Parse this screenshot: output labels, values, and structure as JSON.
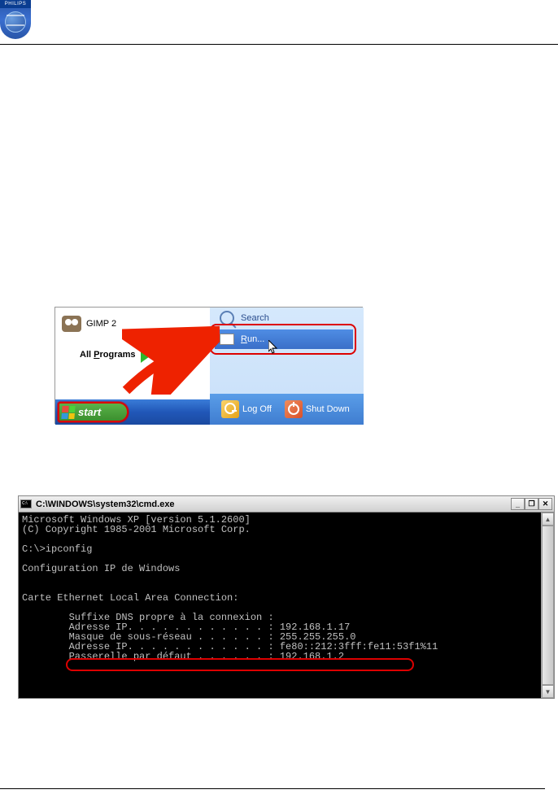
{
  "logo": {
    "brand": "PHILIPS"
  },
  "startmenu": {
    "gimp": "GIMP 2",
    "all_programs_pre": "All ",
    "all_programs_u": "P",
    "all_programs_post": "rograms",
    "search_u": "S",
    "search_post": "earch",
    "run_u": "R",
    "run_post": "un...",
    "logoff_u": "L",
    "logoff_post": "og Off",
    "shutdown": "Sh",
    "shutdown_u": "u",
    "shutdown_post": "t Down",
    "start": "start"
  },
  "cmd": {
    "title": "C:\\WINDOWS\\system32\\cmd.exe",
    "min": "_",
    "max": "❐",
    "close": "✕",
    "line1": "Microsoft Windows XP [version 5.1.2600]",
    "line2": "(C) Copyright 1985-2001 Microsoft Corp.",
    "line3": "",
    "line4": "C:\\>ipconfig",
    "line5": "",
    "line6": "Configuration IP de Windows",
    "line7": "",
    "line8": "",
    "line9": "Carte Ethernet Local Area Connection:",
    "line10": "",
    "line11": "        Suffixe DNS propre à la connexion :",
    "line12": "        Adresse IP. . . . . . . . . . . . : 192.168.1.17",
    "line13": "        Masque de sous-réseau . . . . . . : 255.255.255.0",
    "line14": "        Adresse IP. . . . . . . . . . . . : fe80::212:3fff:fe11:53f1%11",
    "line15": "        Passerelle par défaut . . . . . . : 192.168.1.2"
  }
}
